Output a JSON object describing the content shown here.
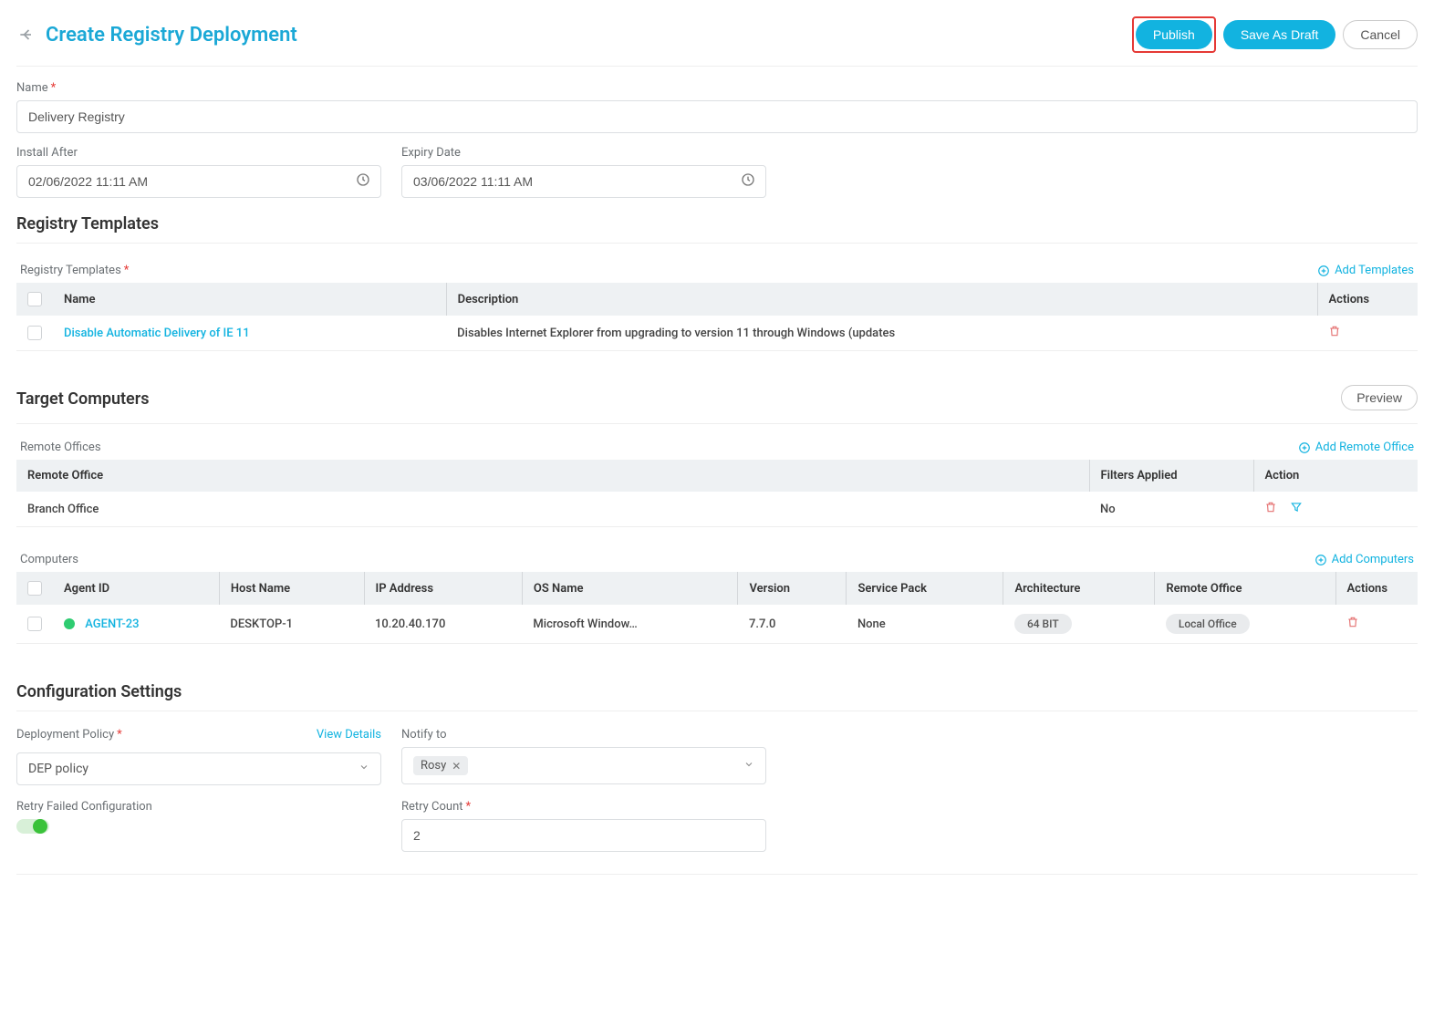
{
  "header": {
    "title": "Create Registry Deployment",
    "buttons": {
      "publish": "Publish",
      "saveDraft": "Save As Draft",
      "cancel": "Cancel"
    }
  },
  "form": {
    "name": {
      "label": "Name",
      "value": "Delivery Registry"
    },
    "installAfter": {
      "label": "Install After",
      "value": "02/06/2022 11:11 AM"
    },
    "expiryDate": {
      "label": "Expiry Date",
      "value": "03/06/2022 11:11 AM"
    }
  },
  "registryTemplates": {
    "title": "Registry Templates",
    "subLabel": "Registry Templates",
    "addLink": "Add Templates",
    "columns": {
      "name": "Name",
      "description": "Description",
      "actions": "Actions"
    },
    "rows": [
      {
        "name": "Disable Automatic Delivery of IE 11",
        "description": "Disables Internet Explorer from upgrading to version 11 through Windows (updates"
      }
    ]
  },
  "targetComputers": {
    "title": "Target Computers",
    "preview": "Preview",
    "remoteOffices": {
      "subLabel": "Remote Offices",
      "addLink": "Add Remote Office",
      "columns": {
        "office": "Remote Office",
        "filters": "Filters Applied",
        "action": "Action"
      },
      "rows": [
        {
          "office": "Branch Office",
          "filters": "No"
        }
      ]
    },
    "computers": {
      "subLabel": "Computers",
      "addLink": "Add Computers",
      "columns": {
        "agent": "Agent ID",
        "host": "Host Name",
        "ip": "IP Address",
        "os": "OS Name",
        "version": "Version",
        "sp": "Service Pack",
        "arch": "Architecture",
        "office": "Remote Office",
        "actions": "Actions"
      },
      "rows": [
        {
          "agent": "AGENT-23",
          "host": "DESKTOP-1",
          "ip": "10.20.40.170",
          "os": "Microsoft Window…",
          "version": "7.7.0",
          "sp": "None",
          "arch": "64 BIT",
          "office": "Local Office"
        }
      ]
    }
  },
  "config": {
    "title": "Configuration Settings",
    "policy": {
      "label": "Deployment Policy",
      "viewDetails": "View Details",
      "value": "DEP policy"
    },
    "notify": {
      "label": "Notify to",
      "values": [
        "Rosy"
      ]
    },
    "retryFailed": {
      "label": "Retry Failed Configuration",
      "on": true
    },
    "retryCount": {
      "label": "Retry Count",
      "value": "2"
    }
  }
}
